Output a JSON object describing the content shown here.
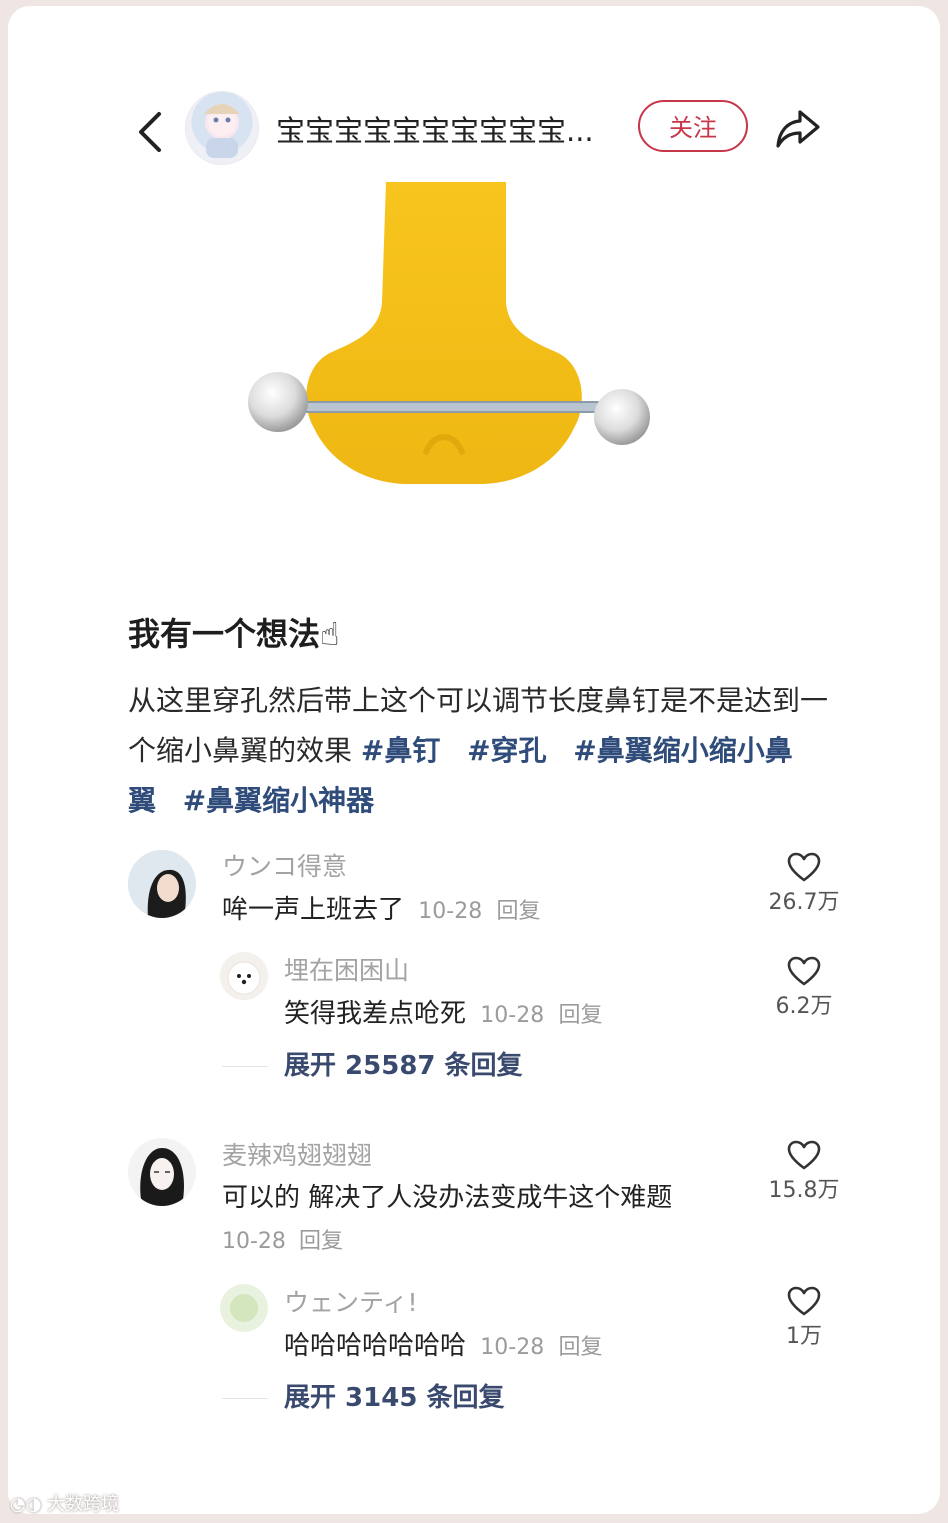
{
  "header": {
    "author_name": "宝宝宝宝宝宝宝宝宝宝...",
    "follow_label": "关注"
  },
  "post": {
    "title": "我有一个想法☝",
    "body_text": "从这里穿孔然后带上这个可以调节长度鼻钉是不是达到一个缩小鼻翼的效果",
    "tags": [
      "#鼻钉",
      "#穿孔",
      "#鼻翼缩小缩小鼻翼",
      "#鼻翼缩小神器"
    ]
  },
  "comments": [
    {
      "user": "ウンコ得意",
      "text": "哞一声上班去了",
      "date": "10-28",
      "reply_label": "回复",
      "likes": "26.7万",
      "replies": [
        {
          "user": "埋在困困山",
          "text": "笑得我差点呛死",
          "date": "10-28",
          "reply_label": "回复",
          "likes": "6.2万"
        }
      ],
      "expand_label": "展开 25587 条回复"
    },
    {
      "user": "麦辣鸡翅翅翅",
      "text": "可以的 解决了人没办法变成牛这个难题",
      "date": "10-28",
      "reply_label": "回复",
      "likes": "15.8万",
      "replies": [
        {
          "user": "ウェンティ!",
          "text": "哈哈哈哈哈哈哈",
          "date": "10-28",
          "reply_label": "回复",
          "likes": "1万"
        }
      ],
      "expand_label": "展开 3145 条回复"
    }
  ],
  "watermark": "大数跨境",
  "colors": {
    "follow_accent": "#c7374a",
    "tag_color": "#2f4c7a",
    "nose_yellow": "#f4c21a"
  }
}
